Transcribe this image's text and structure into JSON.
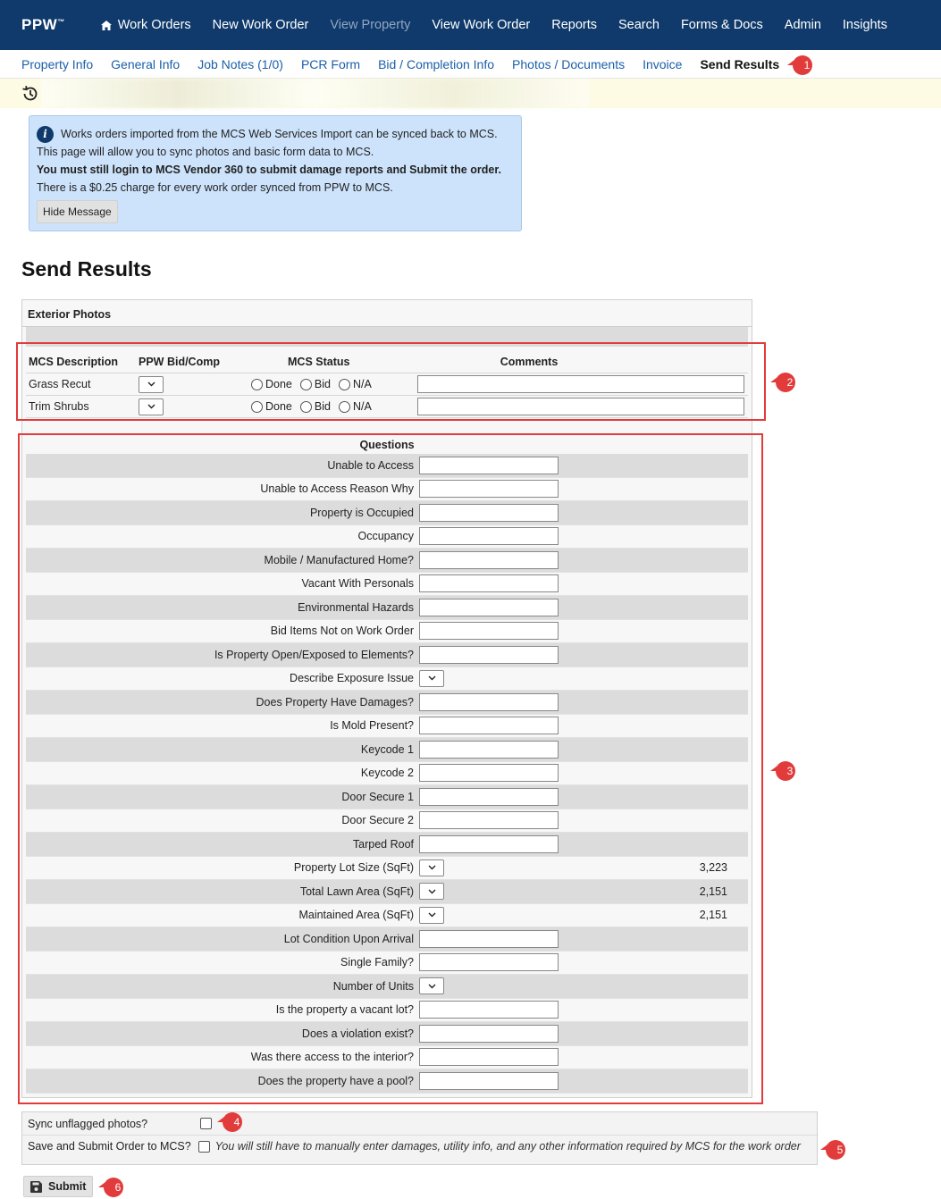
{
  "topnav": {
    "brand": "PPW",
    "brand_mark": "™",
    "items": [
      {
        "label": "Work Orders",
        "icon": "home-icon",
        "dim": false
      },
      {
        "label": "New Work Order",
        "dim": false
      },
      {
        "label": "View Property",
        "dim": true
      },
      {
        "label": "View Work Order",
        "dim": false
      },
      {
        "label": "Reports",
        "dim": false
      },
      {
        "label": "Search",
        "dim": false
      },
      {
        "label": "Forms & Docs",
        "dim": false
      },
      {
        "label": "Admin",
        "dim": false
      },
      {
        "label": "Insights",
        "dim": false
      }
    ]
  },
  "subnav": {
    "items": [
      {
        "label": "Property Info"
      },
      {
        "label": "General Info"
      },
      {
        "label": "Job Notes (1/0)"
      },
      {
        "label": "PCR Form"
      },
      {
        "label": "Bid / Completion Info"
      },
      {
        "label": "Photos / Documents"
      },
      {
        "label": "Invoice"
      },
      {
        "label": "Send Results",
        "active": true
      }
    ]
  },
  "info": {
    "line1": "Works orders imported from the MCS Web Services Import can be synced back to MCS.",
    "line2": "This page will allow you to sync photos and basic form data to MCS.",
    "line3": "You must still login to MCS Vendor 360 to submit damage reports and Submit the order.",
    "line4": "There is a $0.25 charge for every work order synced from PPW to MCS.",
    "hide_label": "Hide Message"
  },
  "page_title": "Send Results",
  "panel": {
    "section_title": "Exterior Photos",
    "headers": {
      "desc": "MCS Description",
      "bid": "PPW Bid/Comp",
      "status": "MCS Status",
      "comments": "Comments"
    },
    "status_options": [
      "Done",
      "Bid",
      "N/A"
    ],
    "rows": [
      {
        "desc": "Grass Recut"
      },
      {
        "desc": "Trim Shrubs"
      }
    ],
    "questions_title": "Questions",
    "questions": [
      {
        "label": "Unable to Access",
        "type": "text",
        "extra": ""
      },
      {
        "label": "Unable to Access Reason Why",
        "type": "text",
        "extra": ""
      },
      {
        "label": "Property is Occupied",
        "type": "text",
        "extra": ""
      },
      {
        "label": "Occupancy",
        "type": "text",
        "extra": ""
      },
      {
        "label": "Mobile / Manufactured Home?",
        "type": "text",
        "extra": ""
      },
      {
        "label": "Vacant With Personals",
        "type": "text",
        "extra": ""
      },
      {
        "label": "Environmental Hazards",
        "type": "text",
        "extra": ""
      },
      {
        "label": "Bid Items Not on Work Order",
        "type": "text",
        "extra": ""
      },
      {
        "label": "Is Property Open/Exposed to Elements?",
        "type": "text",
        "extra": ""
      },
      {
        "label": "Describe Exposure Issue",
        "type": "select",
        "extra": ""
      },
      {
        "label": "Does Property Have Damages?",
        "type": "text",
        "extra": ""
      },
      {
        "label": "Is Mold Present?",
        "type": "text",
        "extra": ""
      },
      {
        "label": "Keycode 1",
        "type": "text",
        "extra": ""
      },
      {
        "label": "Keycode 2",
        "type": "text",
        "extra": ""
      },
      {
        "label": "Door Secure 1",
        "type": "text",
        "extra": ""
      },
      {
        "label": "Door Secure 2",
        "type": "text",
        "extra": ""
      },
      {
        "label": "Tarped Roof",
        "type": "text",
        "extra": ""
      },
      {
        "label": "Property Lot Size (SqFt)",
        "type": "select",
        "extra": "3,223"
      },
      {
        "label": "Total Lawn Area (SqFt)",
        "type": "select",
        "extra": "2,151"
      },
      {
        "label": "Maintained Area (SqFt)",
        "type": "select",
        "extra": "2,151"
      },
      {
        "label": "Lot Condition Upon Arrival",
        "type": "text",
        "extra": ""
      },
      {
        "label": "Single Family?",
        "type": "text",
        "extra": ""
      },
      {
        "label": "Number of Units",
        "type": "select",
        "extra": ""
      },
      {
        "label": "Is the property a vacant lot?",
        "type": "text",
        "extra": ""
      },
      {
        "label": "Does a violation exist?",
        "type": "text",
        "extra": ""
      },
      {
        "label": "Was there access to the interior?",
        "type": "text",
        "extra": ""
      },
      {
        "label": "Does the property have a pool?",
        "type": "text",
        "extra": ""
      }
    ]
  },
  "options": {
    "sync_label": "Sync unflagged photos?",
    "submit_label": "Save and Submit Order to MCS?",
    "submit_note": "You will still have to manually enter damages, utility info, and any other information required by MCS for the work order"
  },
  "submit_button": "Submit",
  "callouts": [
    "1",
    "2",
    "3",
    "4",
    "5",
    "6"
  ],
  "colors": {
    "nav_bg": "#0f3a6b",
    "link": "#1a5fa8",
    "info_bg": "#cde3fb",
    "callout": "#e23b3b"
  }
}
